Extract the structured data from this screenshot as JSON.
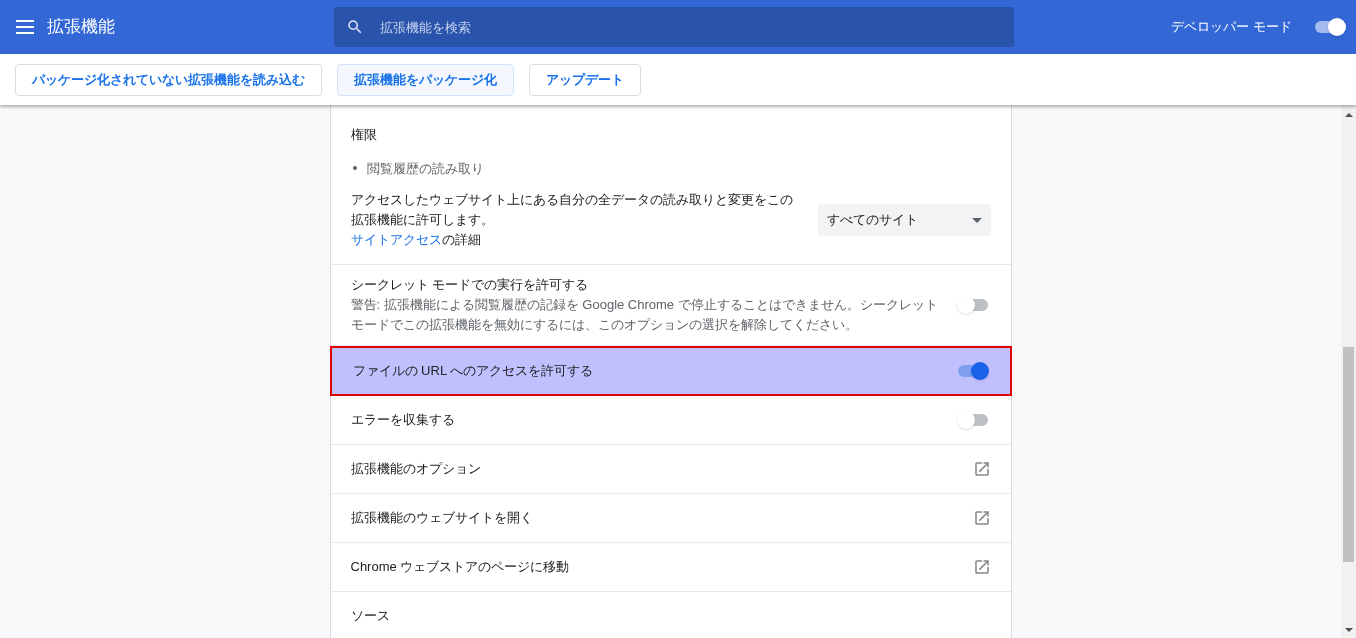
{
  "header": {
    "title": "拡張機能",
    "search": {
      "placeholder": "拡張機能を検索"
    },
    "developer_mode": {
      "label": "デベロッパー モード",
      "on": true
    }
  },
  "toolbar": {
    "buttons": [
      {
        "label": "パッケージ化されていない拡張機能を読み込む",
        "selected": false
      },
      {
        "label": "拡張機能をパッケージ化",
        "selected": true
      },
      {
        "label": "アップデート",
        "selected": false
      }
    ]
  },
  "permissions": {
    "title": "権限",
    "items": [
      "閲覧履歴の読み取り"
    ],
    "site_access": {
      "description": "アクセスしたウェブサイト上にある自分の全データの読み取りと変更をこの拡張機能に許可します。",
      "link": "サイトアクセス",
      "link_suffix": "の詳細",
      "dropdown": "すべてのサイト"
    }
  },
  "rows": [
    {
      "kind": "toggle",
      "label": "シークレット モードでの実行を許可する",
      "description": "警告: 拡張機能による閲覧履歴の記録を Google Chrome で停止することはできません。シークレットモードでこの拡張機能を無効にするには、このオプションの選択を解除してください。",
      "on": false,
      "highlighted": false
    },
    {
      "kind": "toggle",
      "label": "ファイルの URL へのアクセスを許可する",
      "on": true,
      "highlighted": true
    },
    {
      "kind": "toggle",
      "label": "エラーを収集する",
      "on": false,
      "highlighted": false
    },
    {
      "kind": "link",
      "label": "拡張機能のオプション",
      "highlighted": false
    },
    {
      "kind": "link",
      "label": "拡張機能のウェブサイトを開く",
      "highlighted": false
    },
    {
      "kind": "link",
      "label": "Chrome ウェブストアのページに移動",
      "highlighted": false
    },
    {
      "kind": "heading",
      "label": "ソース",
      "highlighted": false
    }
  ]
}
